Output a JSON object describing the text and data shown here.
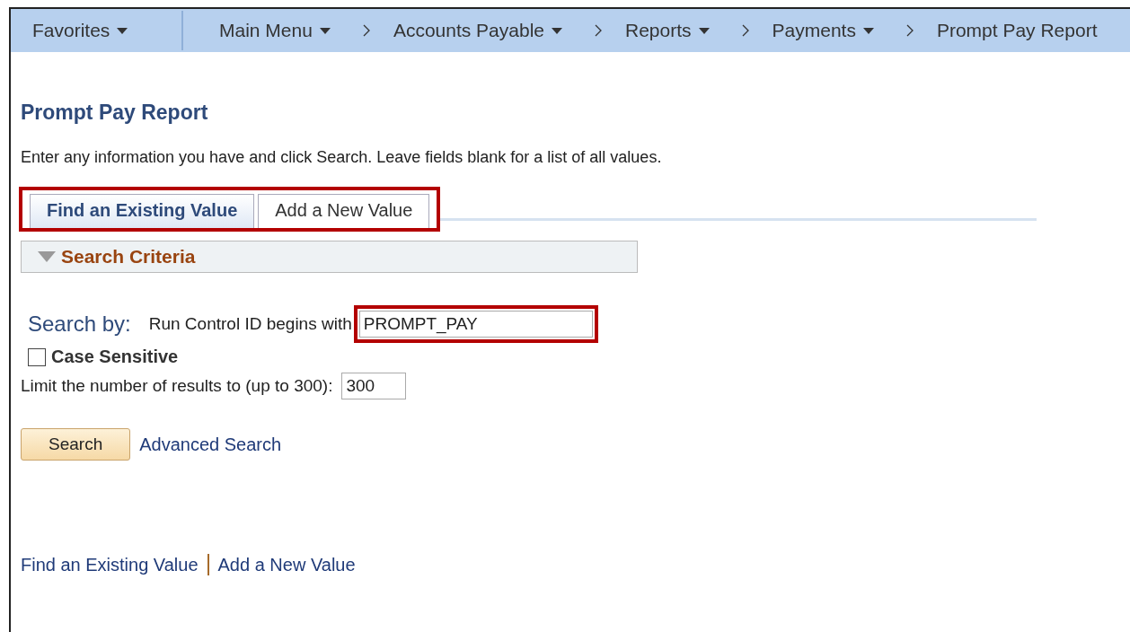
{
  "nav_bar": {
    "favorites": {
      "label": "Favorites",
      "dropdown": true
    },
    "breadcrumbs": [
      {
        "label": "Main Menu",
        "dropdown": true
      },
      {
        "label": "Accounts Payable",
        "dropdown": true
      },
      {
        "label": "Reports",
        "dropdown": true
      },
      {
        "label": "Payments",
        "dropdown": true
      },
      {
        "label": "Prompt Pay Report",
        "dropdown": false
      }
    ]
  },
  "page_title": "Prompt Pay Report",
  "instructions": "Enter any information you have and click Search. Leave fields blank for a list of all values.",
  "tabs": {
    "highlighted": true,
    "items": [
      {
        "label": "Find an Existing Value",
        "selected": true
      },
      {
        "label": "Add a New Value",
        "selected": false
      }
    ]
  },
  "search_criteria": {
    "title": "Search Criteria",
    "expanded": true
  },
  "search_by": {
    "label": "Search by:",
    "field_label": "Run Control ID begins with",
    "value": "PROMPT_PAY",
    "highlighted": true
  },
  "case_sensitive": {
    "label": "Case Sensitive",
    "checked": false
  },
  "limit": {
    "label": "Limit the number of results to (up to 300):",
    "value": "300"
  },
  "search_button": "Search",
  "advanced_search": "Advanced Search",
  "footer_links": [
    "Find an Existing Value",
    "Add a New Value"
  ]
}
